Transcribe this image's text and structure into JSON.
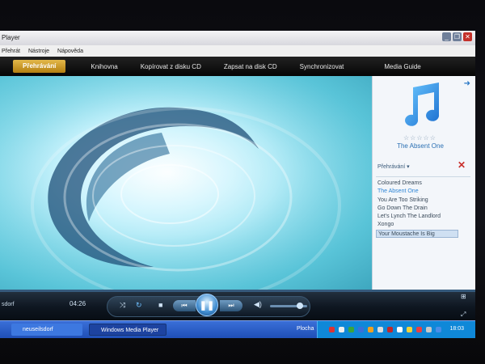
{
  "window": {
    "title": "Player",
    "buttons": {
      "minimize": "_",
      "maximize": "❐",
      "close": "✕"
    }
  },
  "menu": [
    "Přehrát",
    "Nástroje",
    "Nápověda"
  ],
  "nav": {
    "tabs": [
      "Přehrávání",
      "Knihovna",
      "Kopírovat z disku CD",
      "Zapsat na disk CD",
      "Synchronizovat",
      "Media Guide"
    ]
  },
  "pane": {
    "rating": "☆☆☆☆☆",
    "album": "The Absent One",
    "arrow": "➜",
    "playlist_header": "Přehrávání ▾",
    "close": "✕",
    "playlist": [
      "Coloured Dreams",
      "The Absent One",
      "You Are Too Striking",
      "Go Down The Drain",
      "Let's Lynch The Landlord",
      "Xongo",
      "Your Moustache Is Big"
    ]
  },
  "controls": {
    "track": "sdorf",
    "time": "04:26",
    "shuffle": "⤨",
    "repeat": "↻",
    "stop": "■",
    "prev": "⏮",
    "play_pause": "❚❚",
    "next": "⏭",
    "volume_icon": "◀)",
    "volume_level": 0.8,
    "seek_level": 0.0
  },
  "taskbar": {
    "task1": "neuseilsdorf",
    "task2": "Windows Media Player",
    "desktop": "Plocha",
    "clock": "18:03"
  },
  "icons": {
    "note": "music-note-icon",
    "album_arrow": "arrow-right-icon"
  },
  "colors": {
    "accent": "#2a78c6",
    "tab_active": "#d9a52c",
    "taskbar": "#2b5fcc"
  }
}
